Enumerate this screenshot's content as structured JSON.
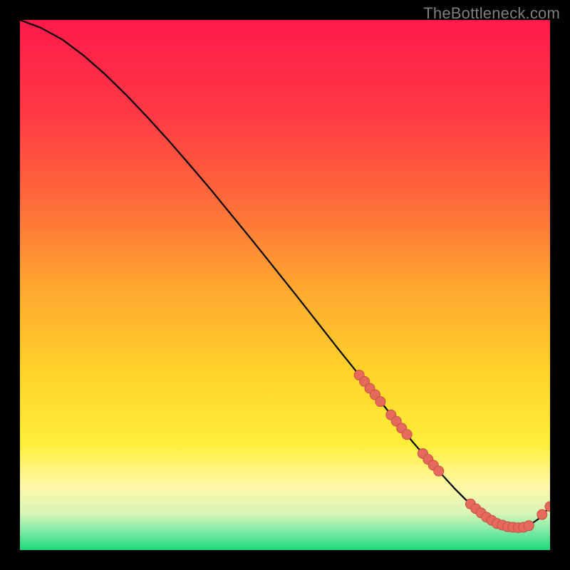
{
  "watermark": "TheBottleneck.com",
  "colors": {
    "background": "#000000",
    "gradient_top": "#ff1a4b",
    "gradient_upper": "#ff5a3a",
    "gradient_mid": "#ffb12a",
    "gradient_lower": "#ffe02a",
    "gradient_pale": "#fff6b0",
    "gradient_green": "#1fe27e",
    "curve": "#000000",
    "marker_fill": "#e66a5c",
    "marker_stroke": "#c94f42",
    "watermark_text": "#7f7f7f"
  },
  "chart_data": {
    "type": "line",
    "title": "",
    "xlabel": "",
    "ylabel": "",
    "xlim": [
      0,
      100
    ],
    "ylim": [
      0,
      100
    ],
    "series": [
      {
        "name": "bottleneck-curve",
        "x": [
          0,
          4,
          8,
          12,
          16,
          20,
          24,
          28,
          32,
          36,
          40,
          44,
          48,
          52,
          56,
          60,
          64,
          66,
          68,
          69,
          70,
          72,
          74,
          76,
          78,
          80,
          82,
          84,
          86,
          88,
          90,
          92,
          94,
          96,
          98,
          100
        ],
        "y": [
          100,
          98.5,
          96.3,
          93.3,
          89.8,
          85.9,
          81.7,
          77.3,
          72.7,
          68.0,
          63.1,
          58.2,
          53.2,
          48.2,
          43.1,
          38.0,
          33.0,
          30.5,
          28.0,
          26.8,
          25.5,
          23.0,
          20.5,
          18.2,
          16.0,
          13.8,
          11.6,
          9.6,
          7.8,
          6.2,
          5.0,
          4.4,
          4.2,
          4.6,
          6.0,
          8.2
        ]
      }
    ],
    "markers": [
      {
        "x": 64,
        "y": 33.0
      },
      {
        "x": 65,
        "y": 31.8
      },
      {
        "x": 66,
        "y": 30.5
      },
      {
        "x": 67,
        "y": 29.3
      },
      {
        "x": 68,
        "y": 28.0
      },
      {
        "x": 70,
        "y": 25.5
      },
      {
        "x": 71,
        "y": 24.3
      },
      {
        "x": 72,
        "y": 23.0
      },
      {
        "x": 73,
        "y": 21.8
      },
      {
        "x": 76,
        "y": 18.2
      },
      {
        "x": 77,
        "y": 17.1
      },
      {
        "x": 78,
        "y": 16.0
      },
      {
        "x": 79,
        "y": 14.9
      },
      {
        "x": 85,
        "y": 8.7
      },
      {
        "x": 86,
        "y": 7.8
      },
      {
        "x": 87,
        "y": 7.0
      },
      {
        "x": 88,
        "y": 6.2
      },
      {
        "x": 89,
        "y": 5.6
      },
      {
        "x": 90,
        "y": 5.0
      },
      {
        "x": 91,
        "y": 4.7
      },
      {
        "x": 92,
        "y": 4.4
      },
      {
        "x": 93,
        "y": 4.3
      },
      {
        "x": 94,
        "y": 4.2
      },
      {
        "x": 95,
        "y": 4.3
      },
      {
        "x": 96,
        "y": 4.6
      },
      {
        "x": 98.5,
        "y": 6.7
      },
      {
        "x": 100,
        "y": 8.2
      }
    ]
  }
}
